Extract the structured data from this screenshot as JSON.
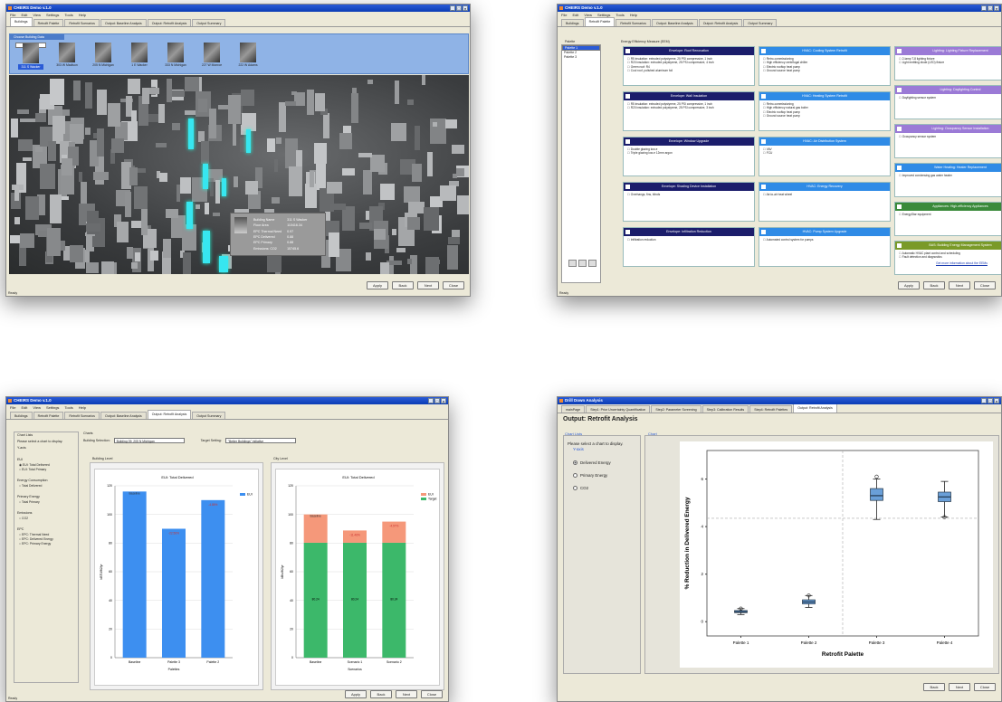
{
  "w1": {
    "title": "CHEIRS Demo v.1.0",
    "menu": [
      "File",
      "Edit",
      "View",
      "Settings",
      "Tools",
      "Help"
    ],
    "tabs": [
      "Buildings",
      "Retrofit Palette",
      "Retrofit Scenarios",
      "Output: Baseline Analysis",
      "Output: Retrofit Analysis",
      "Output Summary"
    ],
    "strip_header": "Choose Building Data",
    "buildings": [
      "311 S Wacker",
      "303 W Madison",
      "205 N Michigan",
      "1 E Wacker",
      "333 N Michigan",
      "227 W Monroe",
      "222 W Adams"
    ],
    "popup": [
      [
        "Building Name",
        "311 S Wacker"
      ],
      [
        "Floor Area",
        "110416.34"
      ],
      [
        "EPC Thermal Need",
        "0.97"
      ],
      [
        "EPC Delivered",
        "0.88"
      ],
      [
        "EPC Primary",
        "0.88"
      ],
      [
        "Emissions: CO2",
        "15745.6"
      ]
    ],
    "buttons": [
      "Apply",
      "Back",
      "Next",
      "Close"
    ],
    "status": "Ready"
  },
  "w2": {
    "title": "CHEIRS Demo v.1.0",
    "menu": [
      "File",
      "Edit",
      "View",
      "Settings",
      "Tools",
      "Help"
    ],
    "tabs": [
      "Buildings",
      "Retrofit Palette",
      "Retrofit Scenarios",
      "Output: Baseline Analysis",
      "Output: Retrofit Analysis",
      "Output Summary"
    ],
    "palette_label": "Palette",
    "palettes": [
      "Palette 1",
      "Palette 2",
      "Palette 3"
    ],
    "ecm_label": "Energy Efficiency Measure (EEM)",
    "col1": [
      {
        "h": "Envelope: Roof Renovation",
        "items": [
          "R5 insulation: extruded polystyrene, 25 PSI compressive, 1 inch",
          "R20 insulation: extruded polystyrene, 25 PSI compressive, 4 inch",
          "Green roof: R4",
          "Cool roof, polished aluminum foil"
        ]
      },
      {
        "h": "Envelope: Wall Insulation",
        "items": [
          "R5 insulation: extruded polystyrene, 25 PSI compressive, 1 inch",
          "R20 insulation: extruded polystyrene, 25 PSI compressive, 3 inch"
        ]
      },
      {
        "h": "Envelope: Window Upgrade",
        "items": [
          "Double glazing low-e",
          "Triple glazing low-e 12mm argon"
        ]
      },
      {
        "h": "Envelope: Shading Device Installation",
        "items": [
          "Overhangs, fins, blinds"
        ]
      },
      {
        "h": "Envelope: Infiltration Reduction",
        "items": [
          "Infiltration reduction"
        ]
      }
    ],
    "col2": [
      {
        "h": "HVAC: Cooling System Retrofit",
        "items": [
          "Retro-commissioning",
          "High efficiency centrifugal chiller",
          "Electric rooftop heat pump",
          "Ground source heat pump"
        ]
      },
      {
        "h": "HVAC: Heating System Retrofit",
        "items": [
          "Retro-commissioning",
          "High efficiency natural gas boiler",
          "Electric rooftop heat pump",
          "Ground source heat pump"
        ]
      },
      {
        "h": "HVAC: Air Distribution System",
        "items": [
          "VAV",
          "FCU"
        ]
      },
      {
        "h": "HVAC: Energy Recovery",
        "items": [
          "Air-to-air heat wheel"
        ]
      },
      {
        "h": "HVAC: Pump System Upgrade",
        "items": [
          "Automated control system for pumps"
        ]
      }
    ],
    "col3": [
      {
        "h": "Lighting: Lighting Fixture Replacement",
        "items": [
          "2-lamp T-8 lighting fixture",
          "Light emitting diode (LED) fixture"
        ]
      },
      {
        "h": "Lighting: Daylighting Control",
        "items": [
          "Daylighting sensor system"
        ]
      },
      {
        "h": "Lighting: Occupancy Sensor Installation",
        "items": [
          "Occupancy sensor system"
        ]
      },
      {
        "h": "Water Heating: Heater Replacement",
        "items": [
          "Improved condensing gas water heater"
        ]
      },
      {
        "h": "Appliances: High-efficiency Appliances",
        "items": [
          "EnergyStar equipment"
        ]
      },
      {
        "h": "BAS: Building Energy Management System",
        "items": [
          "Automatic HVAC plant control and scheduling",
          "Fault detection and diagnostics"
        ]
      }
    ],
    "note": "Get more information about the EEMs",
    "buttons": [
      "Apply",
      "Back",
      "Next",
      "Close"
    ],
    "status": "Ready"
  },
  "w3": {
    "title": "CHEIRS Demo v.1.0",
    "menu": [
      "File",
      "Edit",
      "View",
      "Settings",
      "Tools",
      "Help"
    ],
    "tabs": [
      "Buildings",
      "Retrofit Palette",
      "Retrofit Scenarios",
      "Output: Baseline Analysis",
      "Output: Retrofit Analysis",
      "Output Summary"
    ],
    "chart_lists": "Chart Lists",
    "select_msg": "Please select a chart to display.",
    "yaxis": "Y-axis",
    "groups": [
      {
        "h": "EUI",
        "opts": [
          "EUI: Total Delivered",
          "EUI: Total Primary"
        ]
      },
      {
        "h": "Energy Consumption",
        "opts": [
          "Total Delivered"
        ]
      },
      {
        "h": "Primary Energy",
        "opts": [
          "Total Primary"
        ]
      },
      {
        "h": "Emissions",
        "opts": [
          "CO2"
        ]
      },
      {
        "h": "EPC",
        "opts": [
          "EPC: Thermal Need",
          "EPC: Delivered Energy",
          "EPC: Primary Energy"
        ]
      }
    ],
    "charts_label": "Charts",
    "building_sel_label": "Building Selection:",
    "building_sel": "Building 09: 205 N Michigan",
    "target_label": "Target Setting:",
    "target_sel": "\"Better Buildings\" initiative",
    "bl_label": "Building Level",
    "cl_label": "City Level",
    "buttons": [
      "Apply",
      "Back",
      "Next",
      "Close"
    ],
    "status": "Ready"
  },
  "w4": {
    "title": "Drill Down Analysis",
    "tabs": [
      "mainPage",
      "Step1: Prior Uncertainty Quantification",
      "Step2: Parameter Screening",
      "Step3: Calibration Results",
      "Step4: Retrofit Palettes",
      "Output: Retrofit Analysis"
    ],
    "heading": "Output: Retrofit Analysis",
    "chart_lists": "Chart Lists",
    "chart_label": "Chart",
    "select_msg": "Please select a chart to display.",
    "yaxis": "Y-axis",
    "options": [
      "Delivered Energy",
      "Primary Energy",
      "CO2"
    ],
    "buttons": [
      "Back",
      "Next",
      "Close"
    ]
  },
  "chart_data": [
    {
      "type": "bar",
      "title": "EUI: Total Delivered",
      "categories": [
        "Baseline",
        "Palette 3",
        "Palette 2"
      ],
      "values": [
        116,
        90,
        110
      ],
      "labels": [
        "Baseline",
        "-22.56%",
        "-4.86%"
      ],
      "series": [
        {
          "name": "EUI",
          "values": [
            116,
            90,
            110
          ]
        }
      ],
      "xlabel": "Palettes",
      "ylabel": "kBTU/ft2/yr",
      "ylim": [
        0,
        120
      ],
      "yticks": [
        0,
        20,
        40,
        60,
        80,
        100,
        120
      ],
      "legend": "top-right",
      "color": "#3d8ff0"
    },
    {
      "type": "bar",
      "title": "EUI: Total Delivered",
      "categories": [
        "Baseline",
        "Scenario 1",
        "Scenario 2"
      ],
      "series": [
        {
          "name": "EUI",
          "values": [
            19.76,
            8.56,
            14.76
          ],
          "color": "#f5987a"
        },
        {
          "name": "Target",
          "values": [
            80.24,
            80.24,
            80.24
          ],
          "color": "#3cb86a"
        }
      ],
      "labels": [
        "Baseline",
        "-11.46%",
        "-4.97%"
      ],
      "seg_labels": [
        "80.24",
        "80.24",
        "80.24"
      ],
      "xlabel": "Scenarios",
      "ylabel": "kBtu/ft2/yr",
      "ylim": [
        0,
        120
      ],
      "yticks": [
        0,
        20,
        40,
        60,
        80,
        100,
        120
      ],
      "legend": "top-right"
    },
    {
      "type": "box",
      "categories": [
        "Palette 1",
        "Palette 2",
        "Palette 3",
        "Palette 4"
      ],
      "boxes": [
        {
          "min": 0.3,
          "q1": 0.38,
          "med": 0.42,
          "q3": 0.47,
          "max": 0.55,
          "out": [
            0.55
          ]
        },
        {
          "min": 0.6,
          "q1": 0.75,
          "med": 0.83,
          "q3": 0.92,
          "max": 1.1,
          "out": [
            1.1
          ]
        },
        {
          "min": 4.3,
          "q1": 5.1,
          "med": 5.3,
          "q3": 5.6,
          "max": 6.0,
          "out": [
            6.1
          ]
        },
        {
          "min": 4.4,
          "q1": 5.05,
          "med": 5.25,
          "q3": 5.45,
          "max": 5.9,
          "out": [
            4.4
          ]
        }
      ],
      "xlabel": "Retrofit Palette",
      "ylabel": "% Reduction in Delivered Energy",
      "ylim": [
        -0.6,
        7.2
      ],
      "yticks": [
        0,
        2,
        4,
        6
      ]
    }
  ]
}
